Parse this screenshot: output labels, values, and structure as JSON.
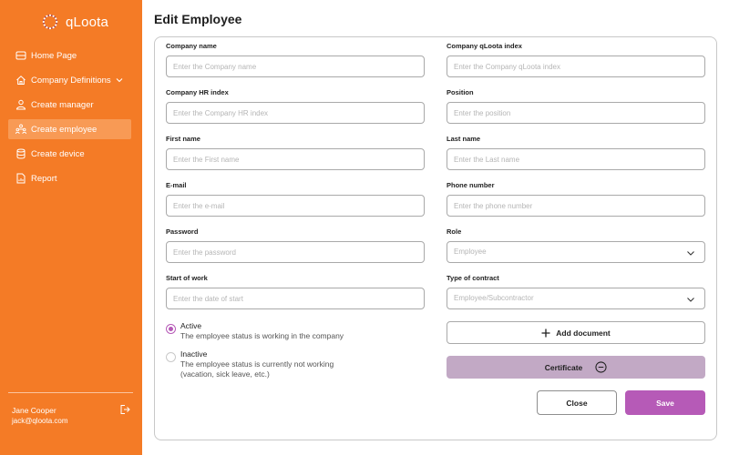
{
  "brand": {
    "name": "qLoota",
    "logo_icon": "qloota-logo-icon"
  },
  "sidebar": {
    "items": [
      {
        "label": "Home Page",
        "icon": "home-page-icon"
      },
      {
        "label": "Company Definitions",
        "icon": "house-icon",
        "has_chevron": true
      },
      {
        "label": "Create manager",
        "icon": "users-icon"
      },
      {
        "label": "Create employee",
        "icon": "employees-icon",
        "active": true
      },
      {
        "label": "Create device",
        "icon": "database-icon"
      },
      {
        "label": "Report",
        "icon": "report-icon"
      }
    ],
    "user": {
      "name": "Jane Cooper",
      "email": "jack@qloota.com"
    },
    "logout_icon": "logout-icon"
  },
  "page": {
    "title": "Edit Employee"
  },
  "form": {
    "company_name": {
      "label": "Company name",
      "placeholder": "Enter the Company name"
    },
    "company_qloota_index": {
      "label": "Company qLoota index",
      "placeholder": "Enter the Company qLoota index"
    },
    "company_hr_index": {
      "label": "Company HR index",
      "placeholder": "Enter the Company HR index"
    },
    "position": {
      "label": "Position",
      "placeholder": "Enter the position"
    },
    "first_name": {
      "label": "First name",
      "placeholder": "Enter the First name"
    },
    "last_name": {
      "label": "Last name",
      "placeholder": "Enter the Last name"
    },
    "email": {
      "label": "E-mail",
      "placeholder": "Enter the e-mail"
    },
    "phone": {
      "label": "Phone number",
      "placeholder": "Enter the phone number"
    },
    "password": {
      "label": "Password",
      "placeholder": "Enter the password"
    },
    "role": {
      "label": "Role",
      "placeholder": "Employee"
    },
    "start_of_work": {
      "label": "Start of work",
      "placeholder": "Enter the date of start"
    },
    "type_of_contract": {
      "label": "Type of contract",
      "placeholder": "Employee/Subcontractor"
    },
    "status": {
      "active": {
        "title": "Active",
        "desc": "The employee status is working in the company",
        "checked": true
      },
      "inactive": {
        "title": "Inactive",
        "desc_line1": "The employee status is currently not working",
        "desc_line2": "(vacation, sick leave, etc.)",
        "checked": false
      }
    }
  },
  "actions": {
    "add_document": "Add document",
    "certificate": "Certificate",
    "close": "Close",
    "save": "Save"
  },
  "colors": {
    "sidebar_bg": "#f47b26",
    "sidebar_active": "#f89a55",
    "accent": "#b65ab7",
    "certificate_bg": "#c2a9c5"
  }
}
